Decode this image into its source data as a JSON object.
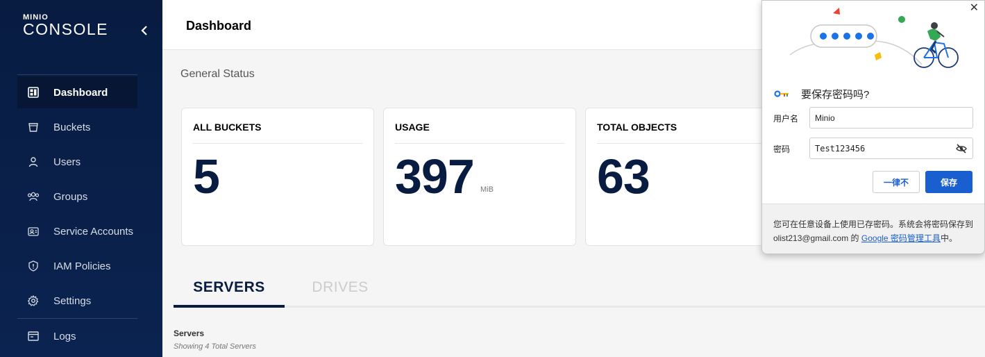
{
  "app": {
    "logo_top": "MINIO",
    "logo_main": "CONSOLE"
  },
  "sidebar": {
    "items": [
      {
        "label": "Dashboard",
        "icon": "dashboard-icon",
        "active": true
      },
      {
        "label": "Buckets",
        "icon": "bucket-icon"
      },
      {
        "label": "Users",
        "icon": "user-icon"
      },
      {
        "label": "Groups",
        "icon": "groups-icon"
      },
      {
        "label": "Service Accounts",
        "icon": "service-account-icon"
      },
      {
        "label": "IAM Policies",
        "icon": "shield-icon"
      },
      {
        "label": "Settings",
        "icon": "gear-icon"
      },
      {
        "label": "Logs",
        "icon": "logs-icon"
      }
    ]
  },
  "header": {
    "title": "Dashboard"
  },
  "main": {
    "section_title": "General Status",
    "cards": [
      {
        "label": "ALL BUCKETS",
        "value": "5",
        "unit": ""
      },
      {
        "label": "USAGE",
        "value": "397",
        "unit": "MiB"
      },
      {
        "label": "TOTAL OBJECTS",
        "value": "63",
        "unit": ""
      }
    ],
    "tabs": [
      {
        "label": "SERVERS",
        "active": true
      },
      {
        "label": "DRIVES",
        "active": false
      }
    ],
    "servers_title": "Servers",
    "servers_subtitle": "Showing 4 Total Servers"
  },
  "password_popup": {
    "title": "要保存密码吗?",
    "username_label": "用户名",
    "username_value": "Minio",
    "password_label": "密码",
    "password_value": "Test123456",
    "never_button": "一律不",
    "save_button": "保存",
    "footer_line1": "您可在任意设备上使用已存密码。系统会将密码保存到",
    "footer_email": "olist213@gmail.com 的 ",
    "footer_link": "Google 密码管理工具",
    "footer_end": "中。"
  },
  "colors": {
    "sidebar_bg": "#081c42",
    "accent": "#081c42",
    "save_blue": "#1a5fd0"
  }
}
